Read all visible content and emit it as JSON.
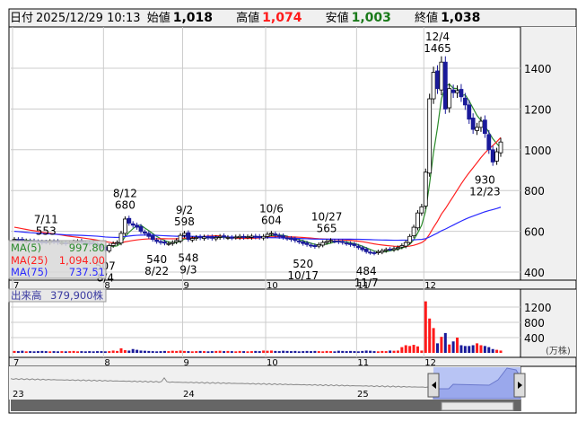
{
  "header": {
    "date_label": "日付",
    "date": "2025/12/29 10:13",
    "open_label": "始値",
    "open": "1,018",
    "high_label": "高値",
    "high": "1,074",
    "low_label": "安値",
    "low": "1,003",
    "close_label": "終値",
    "close": "1,038"
  },
  "legend": {
    "ma5_label": "MA(5)",
    "ma5": "997.80",
    "ma25_label": "MA(25)",
    "ma25": "1,094.00",
    "ma75_label": "MA(75)",
    "ma75": "737.51"
  },
  "volume_label": {
    "label": "出来高",
    "value": "379,900株"
  },
  "colors": {
    "up": "#ffffff",
    "down": "#1a1a9a",
    "ma5": "#2a8a2a",
    "ma25": "#ff2020",
    "ma75": "#2a2aff",
    "vol_up": "#ff1a1a",
    "vol_down": "#1a1a9a"
  },
  "chart_data": {
    "type": "candlestick",
    "price_axis": {
      "ticks": [
        "400",
        "600",
        "800",
        "1000",
        "1200",
        "1400"
      ],
      "ylim": [
        400,
        1400
      ]
    },
    "volume_axis": {
      "ticks": [
        "400",
        "800",
        "1200"
      ],
      "unit": "(万株)"
    },
    "month_labels": [
      {
        "label": "7",
        "index": 0
      },
      {
        "label": "8",
        "index": 23
      },
      {
        "label": "9",
        "index": 43
      },
      {
        "label": "10",
        "index": 64
      },
      {
        "label": "11",
        "index": 87
      },
      {
        "label": "12",
        "index": 104
      }
    ],
    "navigator_labels": [
      "23",
      "24",
      "25"
    ],
    "closes": [
      560,
      558,
      555,
      553,
      550,
      552,
      548,
      545,
      547,
      550,
      548,
      545,
      543,
      540,
      545,
      548,
      550,
      546,
      542,
      540,
      538,
      535,
      520,
      507,
      530,
      540,
      545,
      590,
      660,
      640,
      630,
      620,
      600,
      590,
      575,
      560,
      550,
      545,
      542,
      540,
      545,
      555,
      580,
      590,
      560,
      565,
      570,
      568,
      572,
      570,
      566,
      570,
      575,
      572,
      570,
      568,
      572,
      575,
      570,
      573,
      576,
      572,
      570,
      575,
      585,
      590,
      580,
      575,
      570,
      565,
      560,
      555,
      548,
      540,
      535,
      530,
      525,
      535,
      545,
      550,
      555,
      552,
      548,
      545,
      540,
      535,
      530,
      520,
      510,
      500,
      495,
      492,
      500,
      505,
      510,
      512,
      515,
      520,
      530,
      545,
      575,
      620,
      690,
      720,
      890,
      1250,
      1380,
      1300,
      1430,
      1200,
      1300,
      1280,
      1290,
      1260,
      1220,
      1150,
      1100,
      1110,
      1140,
      1080,
      1000,
      940,
      990,
      1038
    ],
    "volumes": [
      50,
      45,
      55,
      40,
      45,
      40,
      45,
      50,
      45,
      40,
      45,
      40,
      45,
      40,
      45,
      50,
      40,
      45,
      40,
      45,
      40,
      45,
      45,
      40,
      45,
      60,
      50,
      120,
      70,
      60,
      100,
      80,
      60,
      55,
      50,
      45,
      40,
      45,
      50,
      45,
      55,
      50,
      60,
      50,
      45,
      40,
      45,
      50,
      45,
      40,
      45,
      50,
      55,
      45,
      50,
      45,
      40,
      50,
      45,
      40,
      45,
      50,
      45,
      60,
      55,
      60,
      50,
      45,
      55,
      50,
      45,
      50,
      40,
      45,
      50,
      45,
      50,
      45,
      40,
      50,
      45,
      40,
      55,
      50,
      45,
      50,
      45,
      40,
      50,
      60,
      55,
      45,
      40,
      50,
      45,
      60,
      55,
      60,
      150,
      200,
      180,
      210,
      170,
      60,
      1350,
      900,
      650,
      250,
      420,
      520,
      220,
      300,
      400,
      200,
      180,
      180,
      200,
      250,
      200,
      180,
      150,
      100,
      80,
      60
    ],
    "annotations": [
      {
        "date": "7/11",
        "value": "553",
        "index": 8,
        "pos": "above"
      },
      {
        "date": "8/4",
        "value": "507",
        "index": 23,
        "pos": "below"
      },
      {
        "date": "8/12",
        "value": "680",
        "index": 28,
        "pos": "above"
      },
      {
        "date": "8/22",
        "value": "540",
        "index": 36,
        "pos": "below"
      },
      {
        "date": "9/2",
        "value": "598",
        "index": 43,
        "pos": "above"
      },
      {
        "date": "9/3",
        "value": "548",
        "index": 44,
        "pos": "below"
      },
      {
        "date": "10/6",
        "value": "604",
        "index": 65,
        "pos": "above"
      },
      {
        "date": "10/17",
        "value": "520",
        "index": 73,
        "pos": "below"
      },
      {
        "date": "10/27",
        "value": "565",
        "index": 79,
        "pos": "above"
      },
      {
        "date": "11/7",
        "value": "484",
        "index": 89,
        "pos": "below"
      },
      {
        "date": "12/4",
        "value": "1465",
        "index": 107,
        "pos": "above"
      },
      {
        "date": "12/23",
        "value": "930",
        "index": 119,
        "pos": "below"
      }
    ]
  }
}
